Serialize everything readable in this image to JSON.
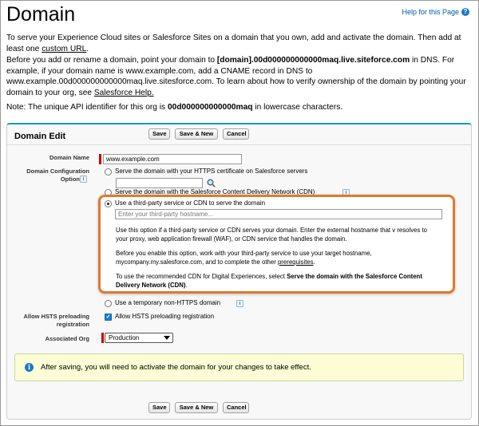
{
  "page": {
    "title": "Domain",
    "help_link": "Help for this Page",
    "intro_1_before": "To serve your Experience Cloud sites or Salesforce Sites on a domain that you own, add and activate the domain. Then add at least one ",
    "intro_1_link": "custom URL",
    "intro_1_after": ".",
    "intro_2_before": "Before you add or rename a domain, point your domain to ",
    "intro_2_bold": "[domain].00d000000000000maq.live.siteforce.com",
    "intro_2_after": " in DNS. For example, if your domain name is www.example.com, add a CNAME record in DNS to www.example.00d000000000000maq.live.sitesforce.com. To learn about how to verify ownership of the domain by pointing your domain to your org, see ",
    "intro_2_link": "Salesforce Help.",
    "note_before": "Note: The unique API identifier for this org is ",
    "note_bold": "00d000000000000maq",
    "note_after": " in lowercase characters."
  },
  "section": {
    "title": "Domain Edit",
    "save": "Save",
    "save_new": "Save & New",
    "cancel": "Cancel"
  },
  "form": {
    "domain_name_label": "Domain Name",
    "domain_name_value": "www.example.com",
    "config_label_1": "Domain Configuration",
    "config_label_2": "Option",
    "option_https": "Serve the domain with your HTTPS certificate on Salesforce servers",
    "option_cdn": "Serve the domain with the Salesforce Content Delivery Network (CDN)",
    "option_third_party": "Use a third-party service or CDN to serve the domain",
    "third_party_placeholder": "Enter your third-party hostname...",
    "desc_1": "Use this option if a third-party service or CDN serves your domain. Enter the external hostname that v resolves to your proxy, web application firewall (WAF), or CDN service that handles the domain.",
    "desc_2_before": "Before you enable this option, work with your third-party service to use your target hostname, mycompany.my.salesforce.com, and to complete the other ",
    "desc_2_link": "prerequisites",
    "desc_2_after": ".",
    "desc_3_before": "To use the recommended CDN for Digital Experiences, select ",
    "desc_3_bold": "Serve the domain with the Salesforce Content Delivery Network (CDN)",
    "desc_3_after": ".",
    "option_non_https": "Use a temporary non-HTTPS domain",
    "hsts_label_1": "Allow HSTS preloading",
    "hsts_label_2": "registration",
    "hsts_option": "Allow HSTS preloading registration",
    "org_label": "Associated Org",
    "org_value": "Production",
    "info_icon": "i"
  },
  "notice": {
    "text": "After saving, you will need to activate the domain for your changes to take effect."
  }
}
